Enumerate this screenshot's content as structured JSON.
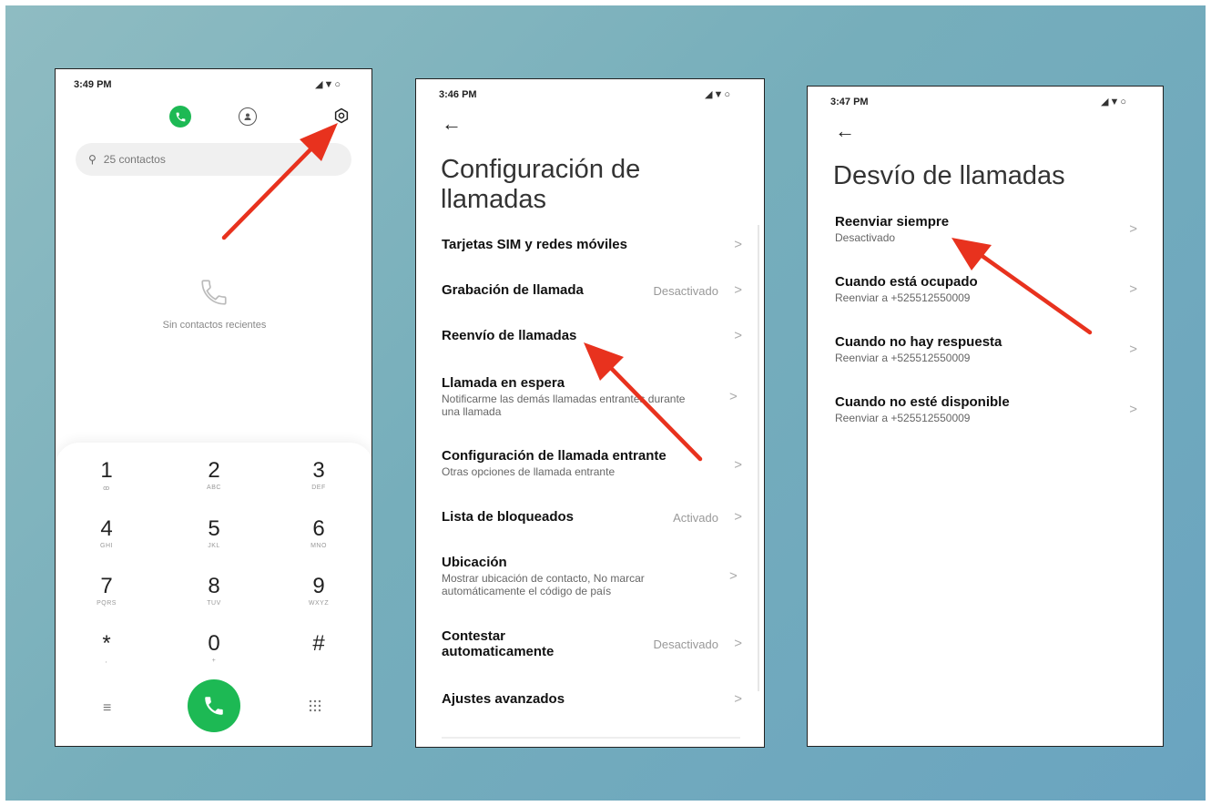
{
  "colors": {
    "accent_green": "#1db954",
    "arrow_red": "#e8321e"
  },
  "phone1": {
    "status_time": "3:49 PM",
    "search_placeholder": "25 contactos",
    "empty_text": "Sin contactos recientes",
    "keys": [
      {
        "num": "1",
        "sub": "ꝏ"
      },
      {
        "num": "2",
        "sub": "ABC"
      },
      {
        "num": "3",
        "sub": "DEF"
      },
      {
        "num": "4",
        "sub": "GHI"
      },
      {
        "num": "5",
        "sub": "JKL"
      },
      {
        "num": "6",
        "sub": "MNO"
      },
      {
        "num": "7",
        "sub": "PQRS"
      },
      {
        "num": "8",
        "sub": "TUV"
      },
      {
        "num": "9",
        "sub": "WXYZ"
      },
      {
        "num": "*",
        "sub": ","
      },
      {
        "num": "0",
        "sub": "+"
      },
      {
        "num": "#",
        "sub": ""
      }
    ]
  },
  "phone2": {
    "status_time": "3:46 PM",
    "title_line1": "Configuración de",
    "title_line2": "llamadas",
    "items": [
      {
        "title": "Tarjetas SIM y redes móviles",
        "desc": "",
        "value": ""
      },
      {
        "title": "Grabación de llamada",
        "desc": "",
        "value": "Desactivado"
      },
      {
        "title": "Reenvío de llamadas",
        "desc": "",
        "value": ""
      },
      {
        "title": "Llamada en espera",
        "desc": "Notificarme las demás llamadas entrantes durante una llamada",
        "value": ""
      },
      {
        "title": "Configuración de llamada entrante",
        "desc": "Otras opciones de llamada entrante",
        "value": ""
      },
      {
        "title": "Lista de bloqueados",
        "desc": "",
        "value": "Activado"
      },
      {
        "title": "Ubicación",
        "desc": "Mostrar ubicación de contacto, No marcar automáticamente el código de país",
        "value": ""
      },
      {
        "title": "Contestar automaticamente",
        "desc": "",
        "value": "Desactivado"
      },
      {
        "title": "Ajustes avanzados",
        "desc": "",
        "value": ""
      }
    ]
  },
  "phone3": {
    "status_time": "3:47 PM",
    "title": "Desvío de llamadas",
    "items": [
      {
        "title": "Reenviar siempre",
        "desc": "Desactivado"
      },
      {
        "title": "Cuando está ocupado",
        "desc": "Reenviar a +525512550009"
      },
      {
        "title": "Cuando no hay respuesta",
        "desc": "Reenviar a +525512550009"
      },
      {
        "title": "Cuando no esté disponible",
        "desc": "Reenviar a +525512550009"
      }
    ]
  },
  "icons": {
    "status": [
      "signal-icon",
      "wifi-icon",
      "battery-icon"
    ],
    "phone1_top": [
      "phone-tab-icon",
      "contacts-tab-icon",
      "settings-gear-icon"
    ],
    "back": "back-arrow-icon",
    "chevron": "chevron-right-icon"
  }
}
